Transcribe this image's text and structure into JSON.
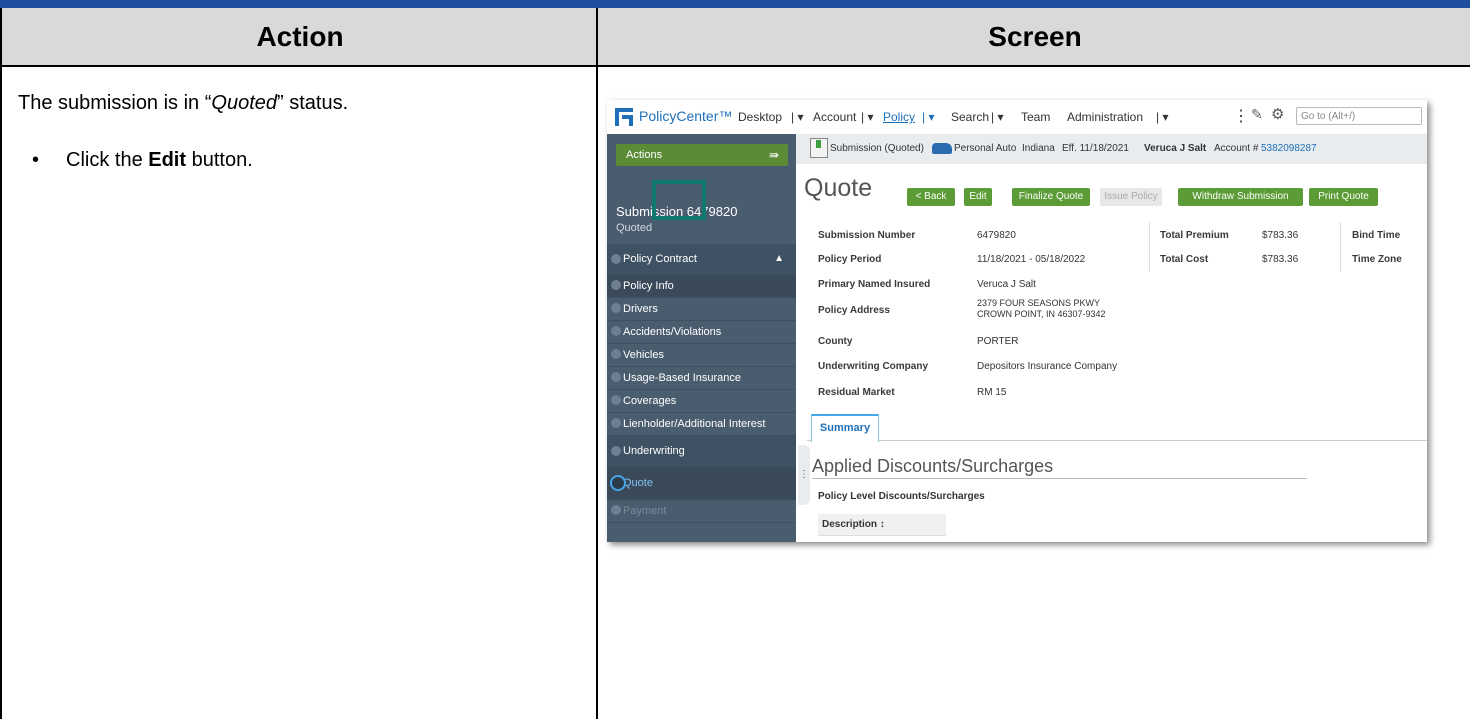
{
  "table": {
    "header_action": "Action",
    "header_screen": "Screen",
    "action_status_prefix": "The submission is in “",
    "action_status_italic": "Quoted",
    "action_status_suffix": "” status.",
    "bullet": "•",
    "action_click_prefix": "Click the ",
    "action_click_bold": "Edit",
    "action_click_suffix": " button."
  },
  "app": {
    "brand": "PolicyCenter™",
    "nav": [
      "Desktop",
      "Account",
      "Policy",
      "Search",
      "Team",
      "Administration"
    ],
    "search_placeholder": "Go to (Alt+/)",
    "actions_label": "Actions",
    "submission_title": "Submission 6479820",
    "submission_status": "Quoted",
    "steps": {
      "policy_contract": "Policy Contract",
      "policy_info": "Policy Info",
      "drivers": "Drivers",
      "accidents": "Accidents/Violations",
      "vehicles": "Vehicles",
      "ubi": "Usage-Based Insurance",
      "coverages": "Coverages",
      "lienholder": "Lienholder/Additional Interest",
      "underwriting": "Underwriting",
      "quote": "Quote",
      "payment": "Payment"
    },
    "context": {
      "submission": "Submission (Quoted)",
      "product": "Personal Auto",
      "state": "Indiana",
      "eff": "Eff. 11/18/2021",
      "insured": "Veruca J Salt",
      "account_label": "Account #",
      "account_number": "5382098287"
    },
    "page_title": "Quote",
    "buttons": {
      "back": "< Back",
      "edit": "Edit",
      "finalize": "Finalize Quote",
      "issue": "Issue Policy",
      "withdraw": "Withdraw Submission",
      "print": "Print Quote"
    },
    "fields": {
      "submission_number_label": "Submission Number",
      "submission_number": "6479820",
      "policy_period_label": "Policy Period",
      "policy_period": "11/18/2021 - 05/18/2022",
      "pni_label": "Primary Named Insured",
      "pni": "Veruca J Salt",
      "policy_address_label": "Policy Address",
      "policy_address_1": "2379 FOUR SEASONS PKWY",
      "policy_address_2": "CROWN POINT, IN 46307-9342",
      "county_label": "County",
      "county": "PORTER",
      "uw_company_label": "Underwriting Company",
      "uw_company": "Depositors Insurance Company",
      "residual_label": "Residual Market",
      "residual": "RM 15",
      "total_premium_label": "Total Premium",
      "total_premium": "$783.36",
      "total_cost_label": "Total Cost",
      "total_cost": "$783.36",
      "bind_time_label": "Bind Time",
      "time_zone_label": "Time Zone"
    },
    "tab_summary": "Summary",
    "applied_title": "Applied Discounts/Surcharges",
    "policy_level_label": "Policy Level Discounts/Surcharges",
    "description_header": "Description ↕"
  },
  "colors": {
    "header_band": "#1f4ea1",
    "nav_green": "#5b9c36",
    "highlight": "#117a70",
    "sidebar": "#4a5d6f",
    "link_blue": "#1d6fb8"
  }
}
